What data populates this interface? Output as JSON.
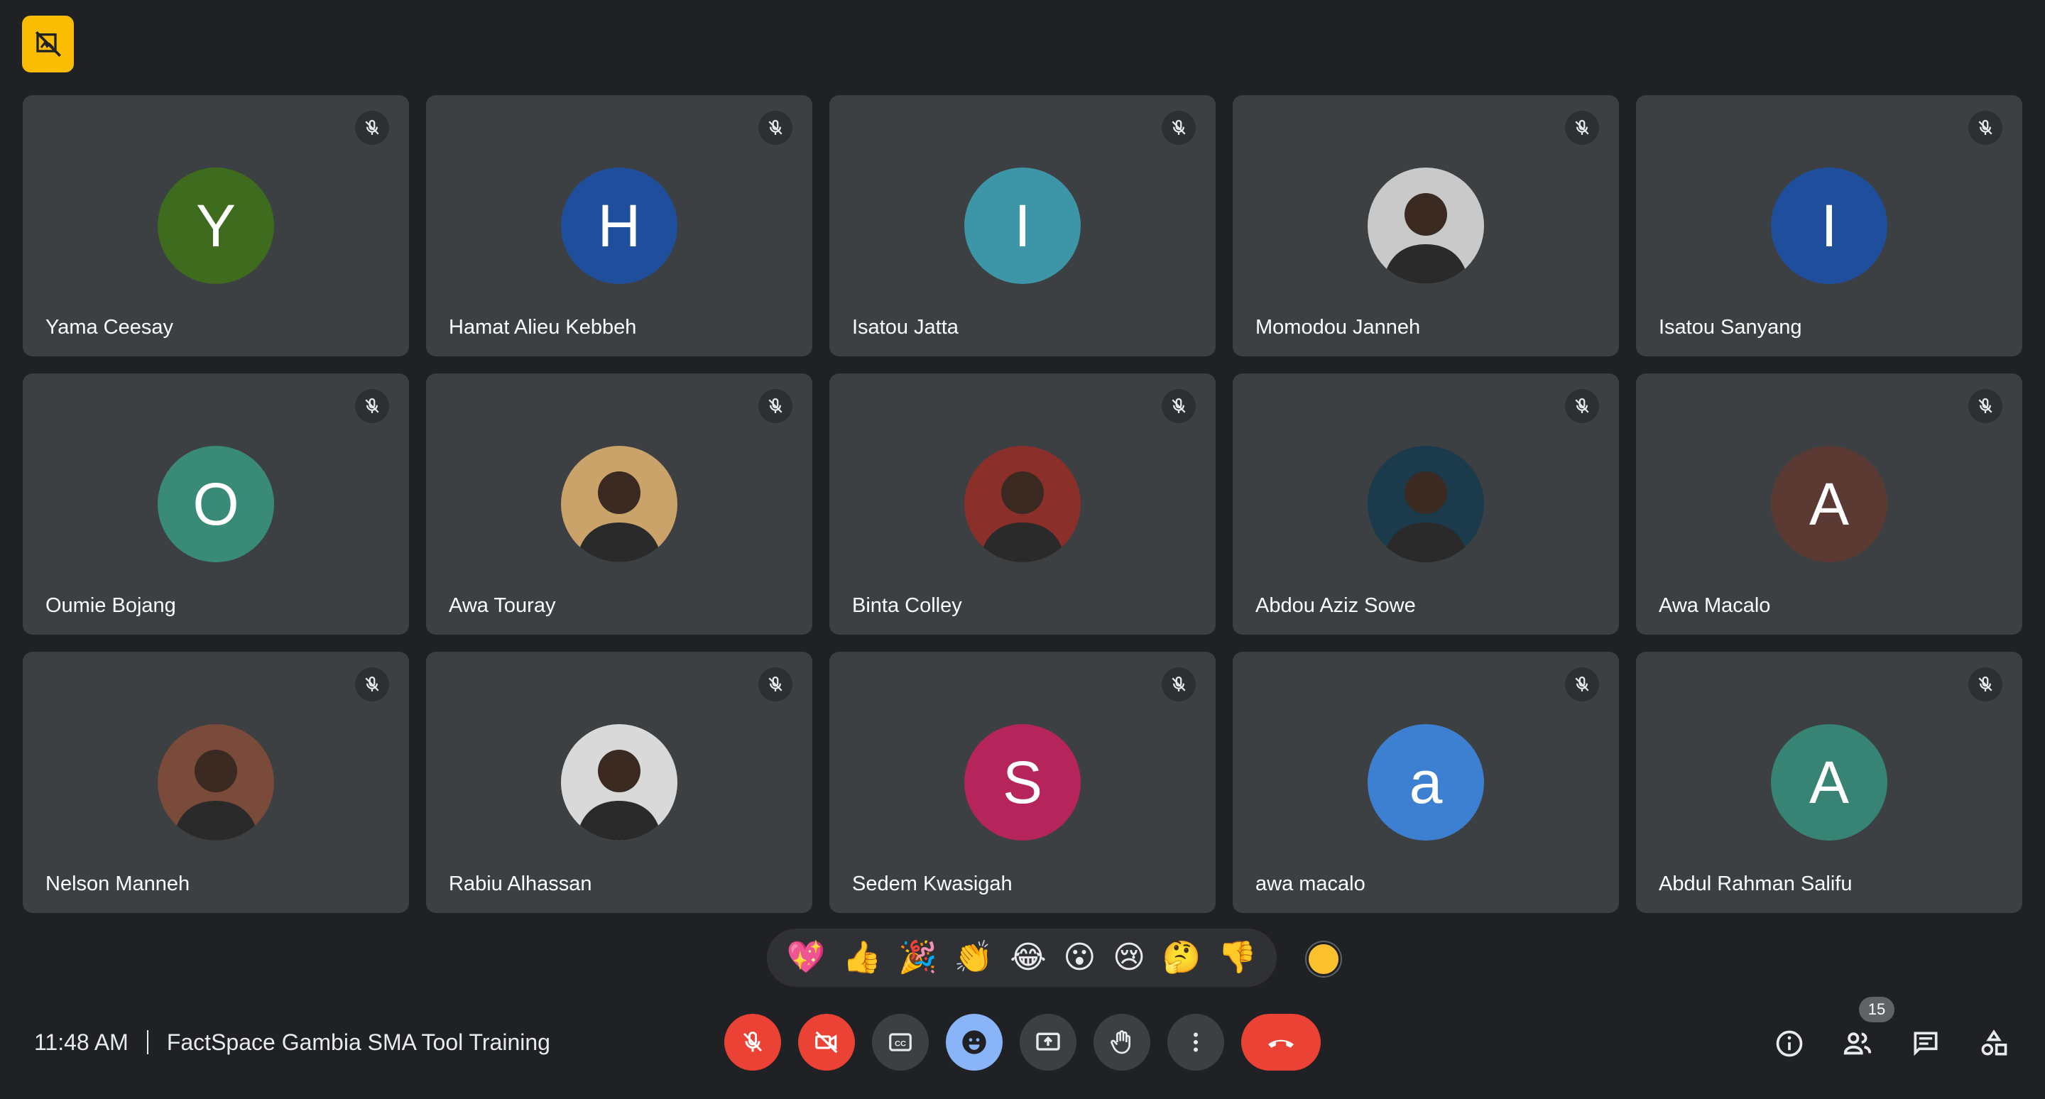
{
  "pinned_badge": {
    "icon": "pin-off-icon",
    "color": "#fbbc04"
  },
  "participants": [
    {
      "name": "Yama Ceesay",
      "initial": "Y",
      "avatar_color": "#3f6b1f",
      "photo": false
    },
    {
      "name": "Hamat Alieu Kebbeh",
      "initial": "H",
      "avatar_color": "#1f4f9c",
      "photo": false
    },
    {
      "name": "Isatou Jatta",
      "initial": "I",
      "avatar_color": "#3d95a8",
      "photo": false
    },
    {
      "name": "Momodou Janneh",
      "initial": "",
      "avatar_color": "#c9c9c9",
      "photo": true
    },
    {
      "name": "Isatou Sanyang",
      "initial": "I",
      "avatar_color": "#1f4f9c",
      "photo": false
    },
    {
      "name": "Oumie Bojang",
      "initial": "O",
      "avatar_color": "#3a8a78",
      "photo": false
    },
    {
      "name": "Awa Touray",
      "initial": "",
      "avatar_color": "#c9a36a",
      "photo": true
    },
    {
      "name": "Binta Colley",
      "initial": "",
      "avatar_color": "#8a2f2a",
      "photo": true
    },
    {
      "name": "Abdou Aziz Sowe",
      "initial": "",
      "avatar_color": "#1b3a4b",
      "photo": true
    },
    {
      "name": "Awa Macalo",
      "initial": "A",
      "avatar_color": "#5a3a32",
      "photo": false
    },
    {
      "name": "Nelson Manneh",
      "initial": "",
      "avatar_color": "#7a4a3a",
      "photo": true
    },
    {
      "name": "Rabiu Alhassan",
      "initial": "",
      "avatar_color": "#d9d9d9",
      "photo": true
    },
    {
      "name": "Sedem Kwasigah",
      "initial": "S",
      "avatar_color": "#b5245a",
      "photo": false
    },
    {
      "name": "awa macalo",
      "initial": "a",
      "avatar_color": "#3d7fd1",
      "photo": false
    },
    {
      "name": "Abdul Rahman Salifu",
      "initial": "A",
      "avatar_color": "#378474",
      "photo": false
    }
  ],
  "reactions": [
    "💖",
    "👍",
    "🎉",
    "👏",
    "😂",
    "😮",
    "😢",
    "🤔",
    "👎"
  ],
  "meeting": {
    "time": "11:48 AM",
    "title": "FactSpace Gambia SMA Tool Training"
  },
  "controls": [
    {
      "name": "mic-toggle",
      "icon": "mic-off-icon",
      "style": "red"
    },
    {
      "name": "camera-toggle",
      "icon": "camera-off-icon",
      "style": "red"
    },
    {
      "name": "captions-toggle",
      "icon": "captions-icon",
      "style": "gray"
    },
    {
      "name": "reactions-toggle",
      "icon": "emoji-icon",
      "style": "blue"
    },
    {
      "name": "present-screen",
      "icon": "present-icon",
      "style": "gray"
    },
    {
      "name": "raise-hand",
      "icon": "hand-icon",
      "style": "gray"
    },
    {
      "name": "more-options",
      "icon": "more-vert-icon",
      "style": "gray"
    },
    {
      "name": "leave-call",
      "icon": "call-end-icon",
      "style": "end"
    }
  ],
  "right_panel": {
    "people_count": "15",
    "icons": [
      "info-icon",
      "people-icon",
      "chat-icon",
      "activities-icon"
    ]
  }
}
